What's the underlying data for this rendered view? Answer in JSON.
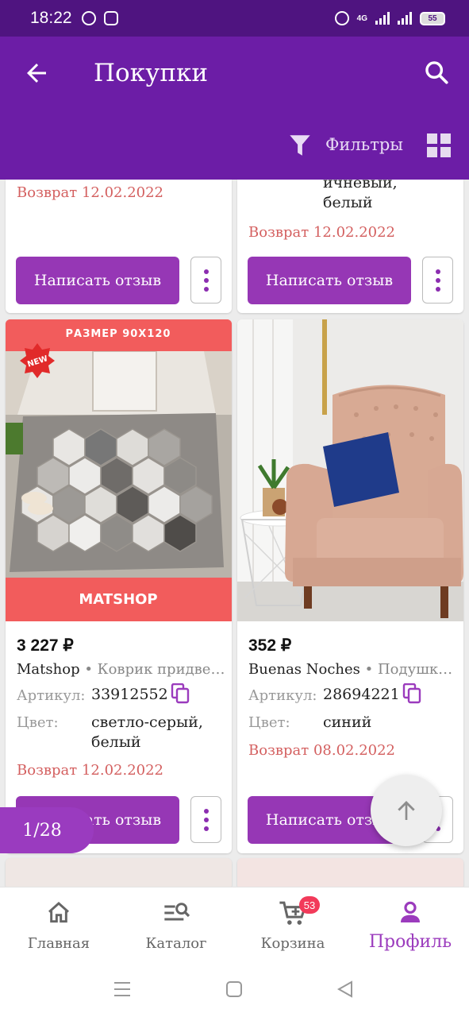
{
  "status_bar": {
    "time": "18:22",
    "network": "4G",
    "battery": "55"
  },
  "app_bar": {
    "title": "Покупки",
    "filters_label": "Фильтры"
  },
  "top_cards": [
    {
      "color_tail": "ичневый,\nбелый",
      "return_text": "Возврат 12.02.2022",
      "review_label": "Написать отзыв"
    },
    {
      "return_text": "Возврат 12.02.2022",
      "review_label": "Написать отзыв"
    }
  ],
  "products": [
    {
      "image_header": "РАЗМЕР 90Х120",
      "image_tag": "NEW",
      "image_footer": "MATSHOP",
      "price": "3 227 ₽",
      "brand": "Matshop",
      "name": "• Коврик придве…",
      "article_label": "Артикул:",
      "article": "33912552",
      "color_label": "Цвет:",
      "color": "светло-серый,\nбелый",
      "return_text": "Возврат 12.02.2022",
      "review_label": "Написать отзыв"
    },
    {
      "price": "352 ₽",
      "brand": "Buenas Noches",
      "name": "• Подушк…",
      "article_label": "Артикул:",
      "article": "28694221",
      "color_label": "Цвет:",
      "color": "синий",
      "return_text": "Возврат 08.02.2022",
      "review_label": "Написать отзыв"
    }
  ],
  "pager": {
    "text": "1/28"
  },
  "bottom_nav": {
    "items": [
      {
        "label": "Главная",
        "icon": "home-icon"
      },
      {
        "label": "Каталог",
        "icon": "catalog-search-icon"
      },
      {
        "label": "Корзина",
        "icon": "cart-icon",
        "badge": "53"
      },
      {
        "label": "Профиль",
        "icon": "profile-icon",
        "active": true
      }
    ]
  },
  "colors": {
    "primary": "#6c1da6",
    "status_bar": "#4f1480",
    "button": "#9637b5",
    "return": "#d46060",
    "badge": "#f23a5a"
  }
}
